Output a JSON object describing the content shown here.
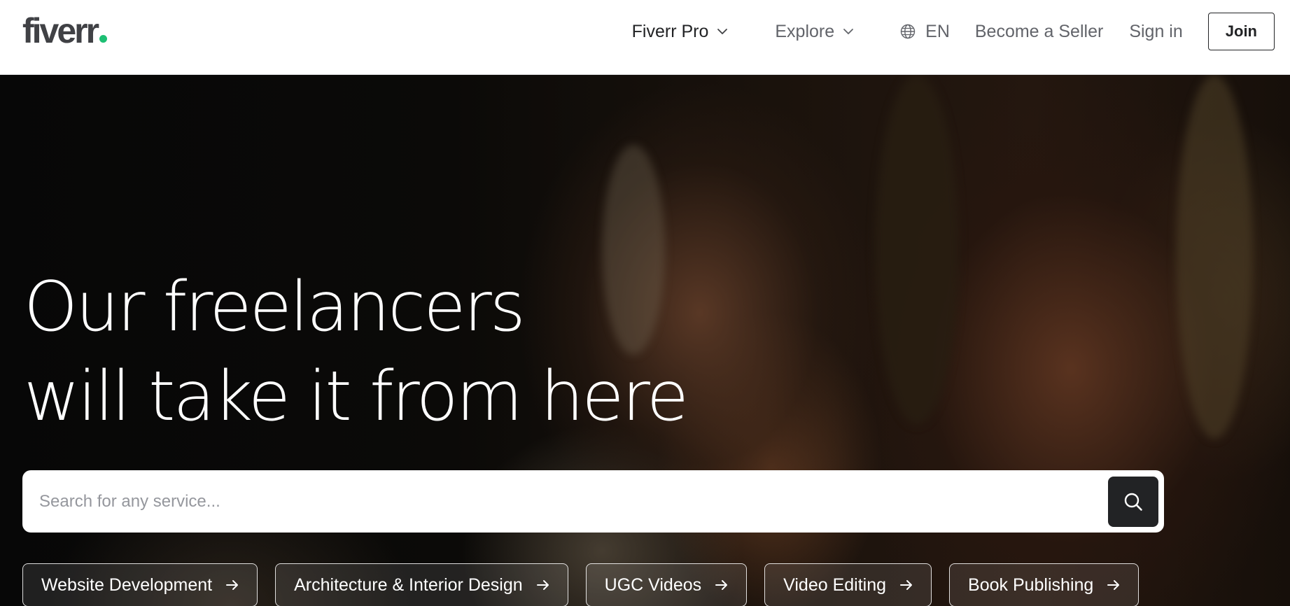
{
  "brand": {
    "logo_text": "fiverr",
    "accent_color": "#1dbf73",
    "text_color": "#404145"
  },
  "nav": {
    "fiverr_pro": "Fiverr Pro",
    "explore": "Explore",
    "language": "EN",
    "become_seller": "Become a Seller",
    "sign_in": "Sign in",
    "join": "Join"
  },
  "icons": {
    "nav_dropdown": "chevron-down-icon",
    "language": "globe-icon",
    "search": "search-icon",
    "chip": "arrow-right-icon"
  },
  "hero": {
    "title_line1": "Our freelancers",
    "title_line2": "will take it from here"
  },
  "search": {
    "placeholder": "Search for any service...",
    "value": ""
  },
  "chips": [
    {
      "label": "Website Development"
    },
    {
      "label": "Architecture & Interior Design"
    },
    {
      "label": "UGC Videos"
    },
    {
      "label": "Video Editing"
    },
    {
      "label": "Book Publishing"
    }
  ]
}
